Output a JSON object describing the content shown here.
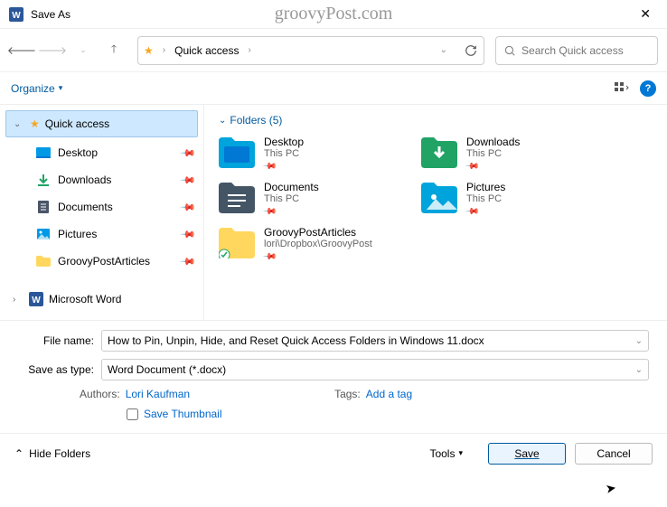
{
  "window": {
    "title": "Save As",
    "watermark": "groovyPost.com"
  },
  "breadcrumb": {
    "location": "Quick access"
  },
  "search": {
    "placeholder": "Search Quick access"
  },
  "toolbar": {
    "organize": "Organize"
  },
  "sidebar": {
    "quick_access": "Quick access",
    "items": [
      {
        "label": "Desktop"
      },
      {
        "label": "Downloads"
      },
      {
        "label": "Documents"
      },
      {
        "label": "Pictures"
      },
      {
        "label": "GroovyPostArticles"
      }
    ],
    "msword": "Microsoft Word"
  },
  "content": {
    "section": "Folders (5)",
    "folders": [
      {
        "name": "Desktop",
        "sub": "This PC"
      },
      {
        "name": "Downloads",
        "sub": "This PC"
      },
      {
        "name": "Documents",
        "sub": "This PC"
      },
      {
        "name": "Pictures",
        "sub": "This PC"
      },
      {
        "name": "GroovyPostArticles",
        "sub": "lori\\Dropbox\\GroovyPost"
      }
    ]
  },
  "form": {
    "filename_label": "File name:",
    "filename_value": "How to Pin, Unpin, Hide, and Reset Quick Access Folders in Windows 11.docx",
    "savetype_label": "Save as type:",
    "savetype_value": "Word Document (*.docx)",
    "authors_label": "Authors:",
    "authors_value": "Lori Kaufman",
    "tags_label": "Tags:",
    "tags_value": "Add a tag",
    "thumbnail": "Save Thumbnail"
  },
  "footer": {
    "hide_folders": "Hide Folders",
    "tools": "Tools",
    "save": "Save",
    "cancel": "Cancel"
  }
}
